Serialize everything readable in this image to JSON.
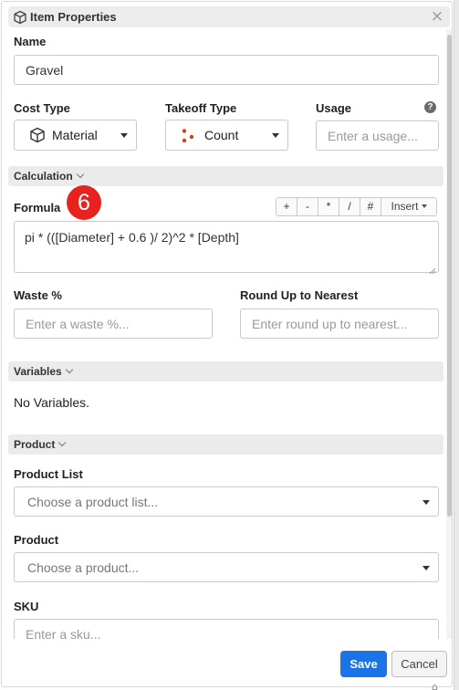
{
  "window": {
    "title": "Item Properties",
    "icon": "cube-icon"
  },
  "name": {
    "label": "Name",
    "value": "Gravel"
  },
  "cost_type": {
    "label": "Cost Type",
    "value": "Material",
    "icon": "cube-icon"
  },
  "takeoff_type": {
    "label": "Takeoff Type",
    "value": "Count",
    "icon": "dots-icon",
    "icon_color": "#c8431a"
  },
  "usage": {
    "label": "Usage",
    "placeholder": "Enter a usage...",
    "help_glyph": "?"
  },
  "sections": {
    "calculation": "Calculation",
    "variables": "Variables",
    "product": "Product"
  },
  "formula": {
    "label": "Formula",
    "badge": "6",
    "badge_color": "#e8231f",
    "operators": [
      "+",
      "-",
      "*",
      "/",
      "#"
    ],
    "insert_label": "Insert",
    "value": "pi * (([Diameter]  + 0.6 )/ 2)^2 * [Depth]"
  },
  "waste": {
    "label": "Waste %",
    "placeholder": "Enter a waste %..."
  },
  "round_up": {
    "label": "Round Up to Nearest",
    "placeholder": "Enter round up to nearest..."
  },
  "variables": {
    "empty_text": "No Variables."
  },
  "product_list": {
    "label": "Product List",
    "placeholder": "Choose a product list..."
  },
  "product": {
    "label": "Product",
    "placeholder": "Choose a product..."
  },
  "sku": {
    "label": "SKU",
    "placeholder": "Enter a sku..."
  },
  "footer": {
    "save_label": "Save",
    "cancel_label": "Cancel",
    "accent": "#1a73e8"
  }
}
